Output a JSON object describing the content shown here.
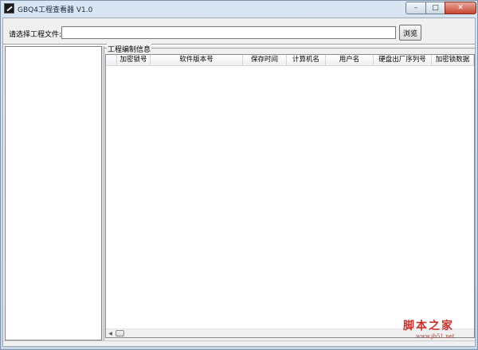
{
  "window": {
    "title": "GBQ4工程查看器 V1.0",
    "controls": {
      "minimize": "–",
      "maximize": "□",
      "close": "✕"
    }
  },
  "file_selector": {
    "label": "请选择工程文件:",
    "value": "",
    "placeholder": "",
    "browse_label": "浏览"
  },
  "info_group": {
    "title": "工程编制信息",
    "columns": [
      "",
      "加密锁号",
      "软件版本号",
      "保存时间",
      "计算机名",
      "用户名",
      "硬盘出厂序列号",
      "加密锁数据"
    ],
    "rows": []
  },
  "watermark": {
    "title": "脚本之家",
    "url": "www.jb51.net"
  },
  "colors": {
    "title_bar": "#d8e5f2",
    "close_button": "#c6452f",
    "client_bg": "#f0f0f0"
  },
  "icons": [
    "app-icon",
    "minimize-icon",
    "maximize-icon",
    "close-icon",
    "scroll-left-icon"
  ]
}
